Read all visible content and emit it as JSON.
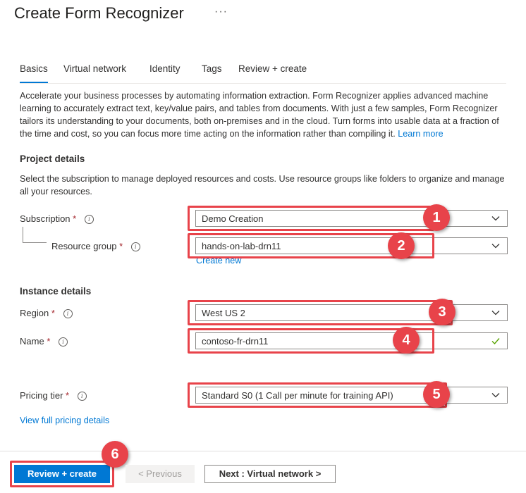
{
  "header": {
    "title": "Create Form Recognizer",
    "more_glyph": "···"
  },
  "tabs": [
    "Basics",
    "Virtual network",
    "Identity",
    "Tags",
    "Review + create"
  ],
  "intro": {
    "text": "Accelerate your business processes by automating information extraction. Form Recognizer applies advanced machine learning to accurately extract text, key/value pairs, and tables from documents. With just a few samples, Form Recognizer tailors its understanding to your documents, both on-premises and in the cloud. Turn forms into usable data at a fraction of the time and cost, so you can focus more time acting on the information rather than compiling it.",
    "link": "Learn more"
  },
  "project": {
    "heading": "Project details",
    "description": "Select the subscription to manage deployed resources and costs. Use resource groups like folders to organize and manage all your resources.",
    "subscription": {
      "label": "Subscription",
      "required": "*",
      "value": "Demo Creation"
    },
    "resource_group": {
      "label": "Resource group",
      "required": "*",
      "value": "hands-on-lab-drn11",
      "create_new": "Create new"
    }
  },
  "instance": {
    "heading": "Instance details",
    "region": {
      "label": "Region",
      "required": "*",
      "value": "West US 2"
    },
    "name": {
      "label": "Name",
      "required": "*",
      "value": "contoso-fr-drn11"
    }
  },
  "pricing": {
    "label": "Pricing tier",
    "required": "*",
    "value": "Standard S0 (1 Call per minute for training API)",
    "details_link": "View full pricing details"
  },
  "footer": {
    "review_create": "Review + create",
    "previous": "< Previous",
    "next": "Next : Virtual network >"
  },
  "annotations": [
    "1",
    "2",
    "3",
    "4",
    "5",
    "6"
  ],
  "colors": {
    "accent": "#0078d4",
    "highlight": "#e8434a",
    "required": "#a4262c",
    "valid": "#57a300"
  }
}
